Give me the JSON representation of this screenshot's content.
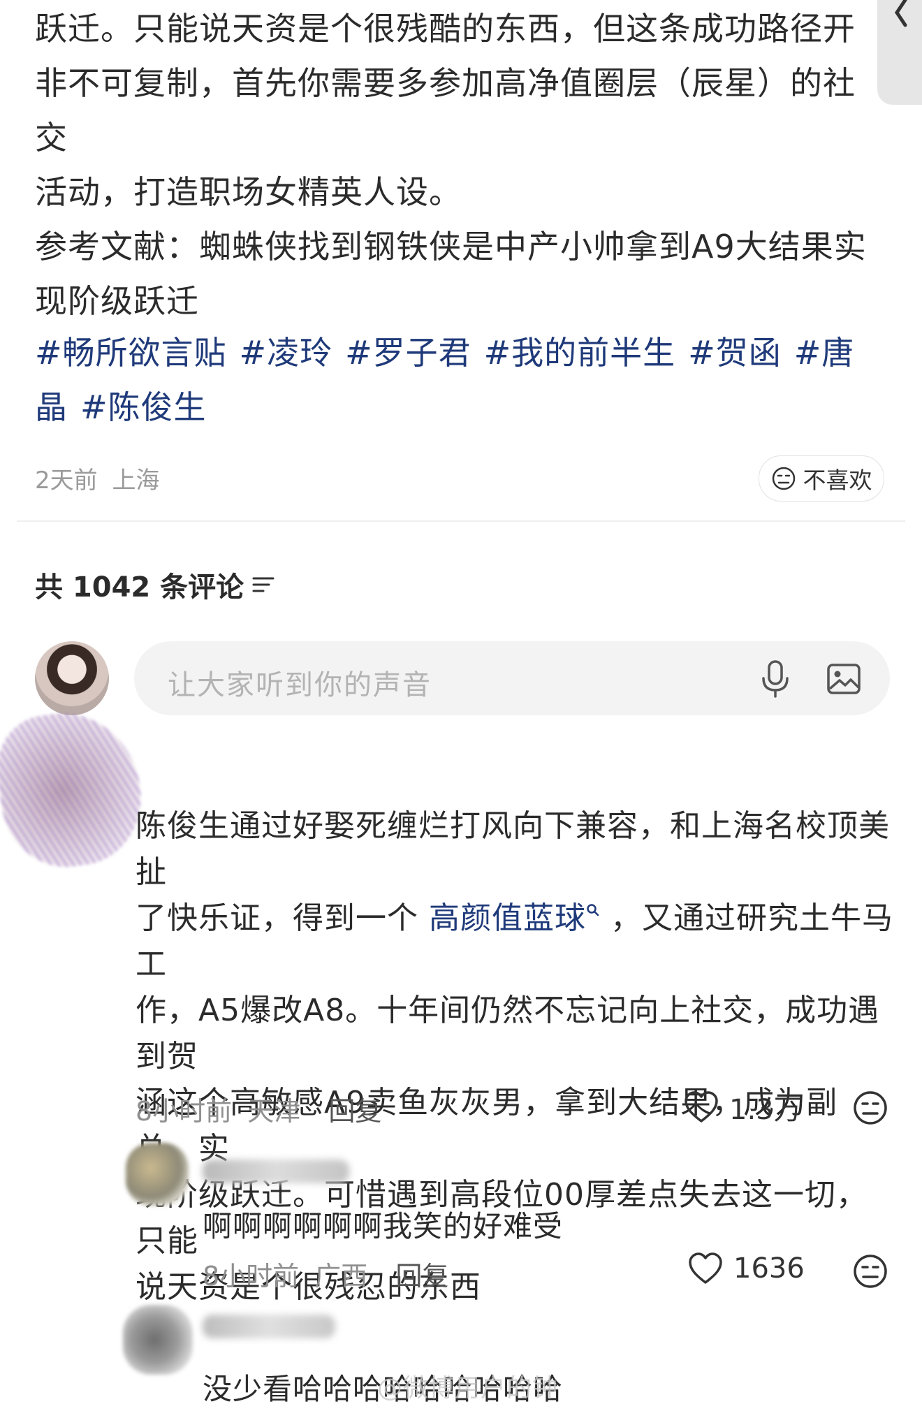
{
  "post": {
    "lines": [
      "跃迁。只能说天资是个很残酷的东西，但这条成功路径开",
      "非不可复制，首先你需要多参加高净值圈层（辰星）的社交",
      "活动，打造职场女精英人设。"
    ],
    "references": [
      "参考文献：蜘蛛侠找到钢铁侠是中产小帅拿到A9大结果实",
      "现阶级跃迁"
    ],
    "hashtags": [
      "#畅所欲言贴",
      "#凌玲",
      "#罗子君",
      "#我的前半生",
      "#贺函",
      "#唐晶",
      "#陈俊生"
    ],
    "time": "2天前",
    "location": "上海",
    "dislike_label": "不喜欢"
  },
  "comments_header": {
    "label": "共 1042 条评论"
  },
  "composer": {
    "placeholder": "让大家听到你的声音",
    "mic_icon": "microphone-icon",
    "image_icon": "image-icon"
  },
  "main_comment": {
    "text_lines": [
      "陈俊生通过好娶死缠烂打风向下兼容，和上海名校顶美扯",
      "作，A5爆改A8。十年间仍然不忘记向上社交，成功遇到贺",
      "涵这个高敏感A9卖鱼灰灰男，拿到大结果，成为副总，实",
      "现阶级跃迁。可惜遇到高段位00厚差点失去这一切，只能",
      "说天资是个很残忍的东西"
    ],
    "line2_prefix": "了快乐证，得到一个",
    "line2_link": "高颜值蓝球",
    "line2_suffix": "，又通过研究土牛马工",
    "time": "8小时前",
    "location": "天津",
    "reply_label": "回复",
    "likes": "1.3万"
  },
  "reply1": {
    "text": "啊啊啊啊啊啊我笑的好难受",
    "time": "8小时前",
    "location": "广西",
    "reply_label": "回复",
    "likes": "1636"
  },
  "reply2": {
    "text": "没少看哈哈哈哈哈哈哈哈哈"
  },
  "watermark": "@微博用户的钟",
  "colors": {
    "link": "#1f3a7a",
    "meta": "#9a9a9a",
    "text": "#2b2b2b"
  }
}
